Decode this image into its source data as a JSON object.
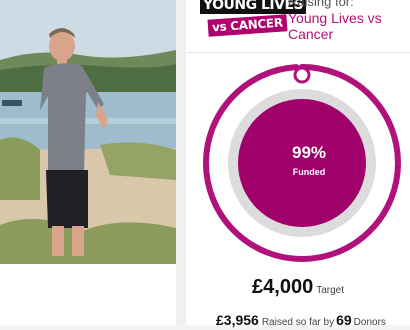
{
  "logo": {
    "line1": "YOUNG LIVES",
    "line2": "vs CANCER"
  },
  "charity": {
    "label": "Raising for:",
    "name": "Young Lives vs Cancer"
  },
  "progress": {
    "percent_text": "99%",
    "percent_value": 99,
    "status": "Funded"
  },
  "target": {
    "amount": "£4,000",
    "label": "Target"
  },
  "raised": {
    "amount": "£3,956",
    "text": "Raised so far by",
    "donor_count": "69",
    "donors_label": "Donors"
  },
  "colors": {
    "brand": "#b0117a",
    "brand_dark": "#a0006a",
    "track": "#d9d9d9"
  }
}
